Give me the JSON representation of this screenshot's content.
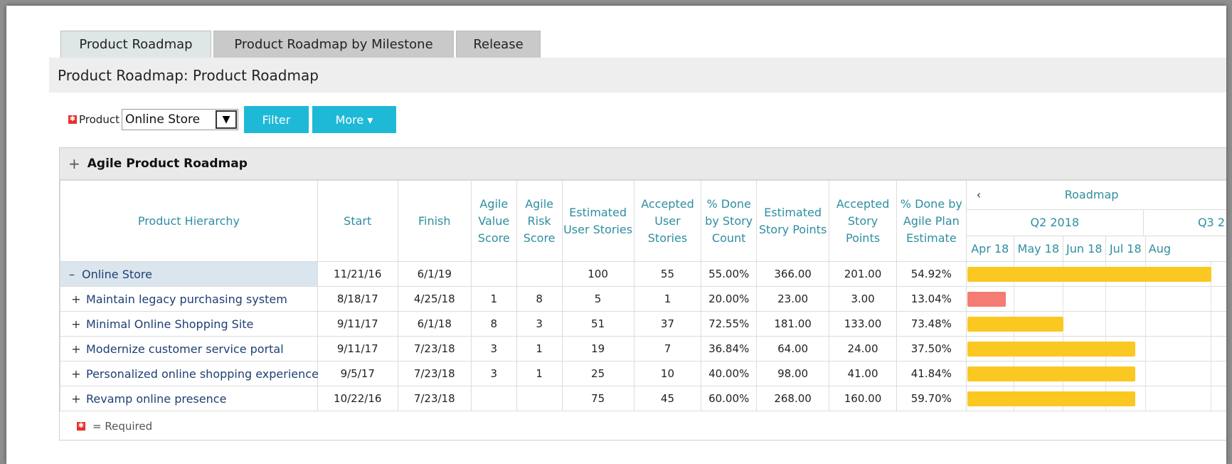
{
  "tabs": [
    {
      "label": "Product Roadmap",
      "active": true
    },
    {
      "label": "Product Roadmap by Milestone",
      "active": false
    },
    {
      "label": "Release",
      "active": false
    }
  ],
  "page_title": "Product Roadmap: Product Roadmap",
  "filter": {
    "product_label": "Product",
    "product_value": "Online Store",
    "filter_button": "Filter",
    "more_button": "More ▾"
  },
  "panel": {
    "title": "Agile Product Roadmap",
    "columns": [
      "Product Hierarchy",
      "Start",
      "Finish",
      "Agile Value Score",
      "Agile Risk Score",
      "Estimated User Stories",
      "Accepted User Stories",
      "% Done by Story Count",
      "Estimated Story Points",
      "Accepted Story Points",
      "% Done by Agile Plan Estimate"
    ],
    "roadmap": {
      "label": "Roadmap",
      "quarters": [
        "Q2 2018",
        "Q3 2"
      ],
      "months": [
        "Apr 18",
        "May 18",
        "Jun 18",
        "Jul 18",
        "Aug"
      ]
    },
    "rows": [
      {
        "toggle": "–",
        "name": "Online Store",
        "start": "11/21/16",
        "finish": "6/1/19",
        "value": "",
        "risk": "",
        "est_us": "100",
        "acc_us": "55",
        "pct_count": "55.00%",
        "est_sp": "366.00",
        "acc_sp": "201.00",
        "pct_plan": "54.92%",
        "bar": {
          "from": 0,
          "to": 1.0,
          "color": "#fbc822"
        }
      },
      {
        "toggle": "+",
        "name": "Maintain legacy purchasing system",
        "start": "8/18/17",
        "finish": "4/25/18",
        "value": "1",
        "risk": "8",
        "est_us": "5",
        "acc_us": "1",
        "pct_count": "20.00%",
        "est_sp": "23.00",
        "acc_sp": "3.00",
        "pct_plan": "13.04%",
        "bar": {
          "from": 0,
          "to": 0.83,
          "color": "#f47c74"
        }
      },
      {
        "toggle": "+",
        "name": "Minimal Online Shopping Site",
        "start": "9/11/17",
        "finish": "6/1/18",
        "value": "8",
        "risk": "3",
        "est_us": "51",
        "acc_us": "37",
        "pct_count": "72.55%",
        "est_sp": "181.00",
        "acc_sp": "133.00",
        "pct_plan": "73.48%",
        "bar": {
          "from": 0,
          "to": 2.0,
          "color": "#fbc822"
        }
      },
      {
        "toggle": "+",
        "name": "Modernize customer service portal",
        "start": "9/11/17",
        "finish": "7/23/18",
        "value": "3",
        "risk": "1",
        "est_us": "19",
        "acc_us": "7",
        "pct_count": "36.84%",
        "est_sp": "64.00",
        "acc_sp": "24.00",
        "pct_plan": "37.50%",
        "bar": {
          "from": 0,
          "to": 3.73,
          "color": "#fbc822"
        }
      },
      {
        "toggle": "+",
        "name": "Personalized online shopping experience",
        "start": "9/5/17",
        "finish": "7/23/18",
        "value": "3",
        "risk": "1",
        "est_us": "25",
        "acc_us": "10",
        "pct_count": "40.00%",
        "est_sp": "98.00",
        "acc_sp": "41.00",
        "pct_plan": "41.84%",
        "bar": {
          "from": 0,
          "to": 3.73,
          "color": "#fbc822"
        }
      },
      {
        "toggle": "+",
        "name": "Revamp online presence",
        "start": "10/22/16",
        "finish": "7/23/18",
        "value": "",
        "risk": "",
        "est_us": "75",
        "acc_us": "45",
        "pct_count": "60.00%",
        "est_sp": "268.00",
        "acc_sp": "160.00",
        "pct_plan": "59.70%",
        "bar": {
          "from": 0,
          "to": 3.73,
          "color": "#fbc822"
        }
      }
    ],
    "legend": "= Required"
  }
}
